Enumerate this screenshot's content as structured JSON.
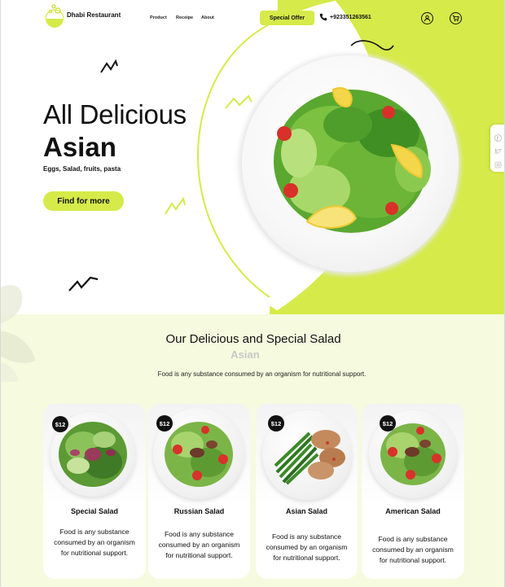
{
  "brand": {
    "name": "Dhabi Restaurant"
  },
  "nav": {
    "product": "Product",
    "recipe": "Receipe",
    "about": "About"
  },
  "header": {
    "offer_label": "Special Offer",
    "phone": "+923351263561"
  },
  "hero": {
    "title_line1": "All Delicious",
    "title_line2": "Asian",
    "subtitle": "Eggs, Salad, fruits, pasta",
    "cta_label": "Find for more"
  },
  "section": {
    "title": "Our Delicious and Special Salad",
    "subtitle": "Asian",
    "description": "Food is any substance consumed by an organism for nutritional support."
  },
  "cards": [
    {
      "price": "$12",
      "name": "Special Salad",
      "desc_l1": "Food is any substance",
      "desc_l2": "consumed by an organism",
      "desc_l3": "for nutritional support."
    },
    {
      "price": "$12",
      "name": "Russian Salad",
      "desc_l1": "Food is any substance",
      "desc_l2": "consumed by an organism",
      "desc_l3": "for nutritional support."
    },
    {
      "price": "$12",
      "name": "Asian Salad",
      "desc_l1": "Food is any substance",
      "desc_l2": "consumed by an organism",
      "desc_l3": "for nutritional support."
    },
    {
      "price": "$12",
      "name": "American Salad",
      "desc_l1": "Food is any substance",
      "desc_l2": "consumed by an organism",
      "desc_l3": "for nutritional support."
    }
  ],
  "social": [
    "facebook-icon",
    "twitter-icon",
    "instagram-icon"
  ],
  "colors": {
    "accent": "#d6ea4a",
    "section_bg": "#f6fadf",
    "text": "#111111"
  }
}
